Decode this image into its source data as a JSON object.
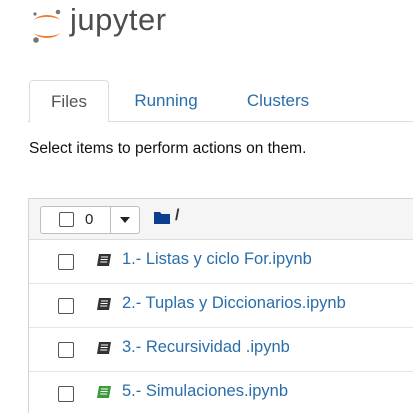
{
  "header": {
    "logo_text": "jupyter",
    "logo_colors": {
      "orange": "#f37726",
      "gray": "#767677"
    }
  },
  "tabs": [
    {
      "label": "Files",
      "active": true
    },
    {
      "label": "Running",
      "active": false
    },
    {
      "label": "Clusters",
      "active": false
    }
  ],
  "instructions": "Select items to perform actions on them.",
  "toolbar": {
    "selected_count": "0",
    "path": "/",
    "icons": [
      "checkbox",
      "caret-down-icon",
      "folder-icon"
    ]
  },
  "files": [
    {
      "name": "1.- Listas y ciclo For.ipynb",
      "icon": "notebook-icon",
      "running": false
    },
    {
      "name": "2.- Tuplas y Diccionarios.ipynb",
      "icon": "notebook-icon",
      "running": false
    },
    {
      "name": "3.- Recursividad .ipynb",
      "icon": "notebook-icon",
      "running": false
    },
    {
      "name": "5.- Simulaciones.ipynb",
      "icon": "notebook-icon",
      "running": true
    }
  ],
  "colors": {
    "link": "#296eaa",
    "notebook_idle": "#333333",
    "notebook_running": "#3c9a3c"
  }
}
